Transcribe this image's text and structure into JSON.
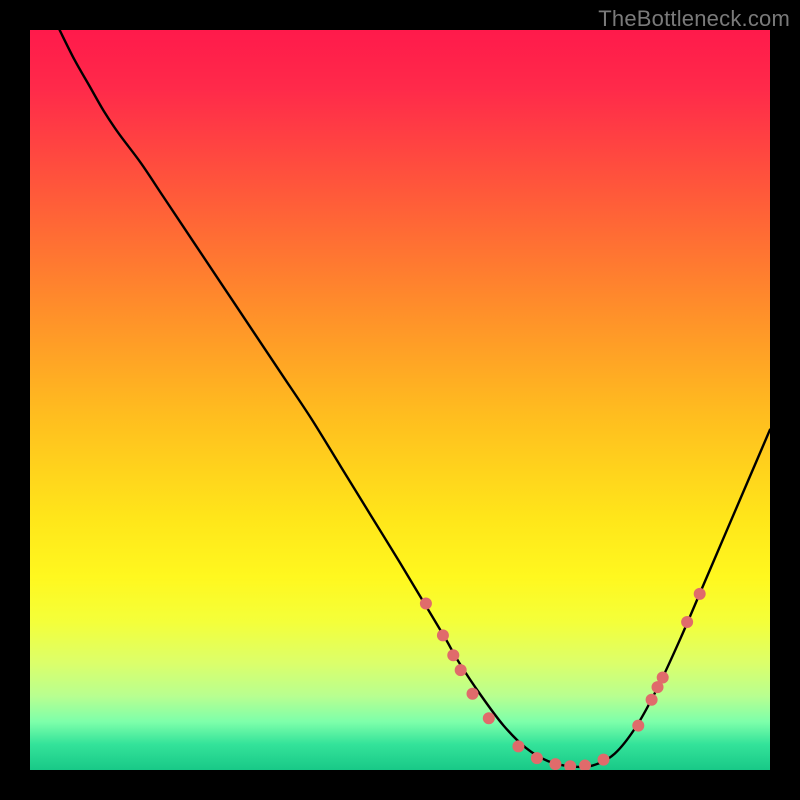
{
  "attribution": "TheBottleneck.com",
  "chart_data": {
    "type": "line",
    "title": "",
    "xlabel": "",
    "ylabel": "",
    "xlim": [
      0,
      100
    ],
    "ylim": [
      0,
      100
    ],
    "grid": false,
    "legend": false,
    "background_gradient": {
      "stops": [
        {
          "offset": 0.0,
          "color": "#ff1a4b"
        },
        {
          "offset": 0.08,
          "color": "#ff2a4a"
        },
        {
          "offset": 0.22,
          "color": "#ff593a"
        },
        {
          "offset": 0.38,
          "color": "#ff8f2a"
        },
        {
          "offset": 0.52,
          "color": "#ffbd1f"
        },
        {
          "offset": 0.66,
          "color": "#ffe61a"
        },
        {
          "offset": 0.74,
          "color": "#fff81f"
        },
        {
          "offset": 0.8,
          "color": "#f4ff3a"
        },
        {
          "offset": 0.855,
          "color": "#dcff6a"
        },
        {
          "offset": 0.9,
          "color": "#b8ff90"
        },
        {
          "offset": 0.935,
          "color": "#7dffaa"
        },
        {
          "offset": 0.965,
          "color": "#34e39a"
        },
        {
          "offset": 1.0,
          "color": "#18c987"
        }
      ]
    },
    "series": [
      {
        "name": "bottleneck-curve",
        "stroke": "#000000",
        "stroke_width": 2.4,
        "x": [
          4,
          6,
          8,
          10,
          12,
          15,
          18,
          22,
          26,
          30,
          34,
          38,
          42,
          46,
          50,
          53,
          56,
          58,
          61,
          64,
          67,
          70,
          73,
          76,
          79,
          82,
          85,
          88,
          91,
          94,
          97,
          100
        ],
        "y": [
          100,
          96,
          92.5,
          89,
          86,
          82,
          77.5,
          71.5,
          65.5,
          59.5,
          53.5,
          47.5,
          41,
          34.5,
          28,
          23,
          18,
          14.5,
          10,
          6,
          3,
          1.2,
          0.5,
          0.6,
          2.2,
          6,
          11.5,
          18,
          25,
          32,
          39,
          46
        ]
      }
    ],
    "markers": {
      "name": "highlight-dots",
      "fill": "#e06b6b",
      "radius": 6,
      "points": [
        {
          "x": 53.5,
          "y": 22.5
        },
        {
          "x": 55.8,
          "y": 18.2
        },
        {
          "x": 57.2,
          "y": 15.5
        },
        {
          "x": 58.2,
          "y": 13.5
        },
        {
          "x": 59.8,
          "y": 10.3
        },
        {
          "x": 62.0,
          "y": 7.0
        },
        {
          "x": 66.0,
          "y": 3.2
        },
        {
          "x": 68.5,
          "y": 1.6
        },
        {
          "x": 71.0,
          "y": 0.8
        },
        {
          "x": 73.0,
          "y": 0.5
        },
        {
          "x": 75.0,
          "y": 0.6
        },
        {
          "x": 77.5,
          "y": 1.4
        },
        {
          "x": 82.2,
          "y": 6.0
        },
        {
          "x": 84.0,
          "y": 9.5
        },
        {
          "x": 84.8,
          "y": 11.2
        },
        {
          "x": 85.5,
          "y": 12.5
        },
        {
          "x": 88.8,
          "y": 20.0
        },
        {
          "x": 90.5,
          "y": 23.8
        }
      ]
    }
  }
}
